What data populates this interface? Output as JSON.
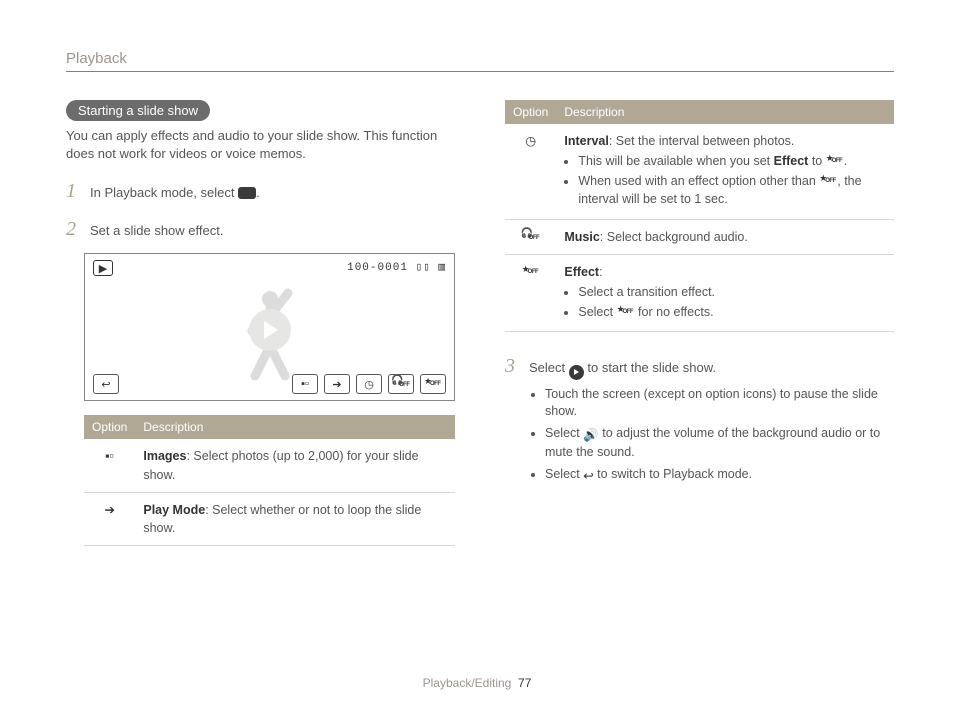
{
  "header": {
    "section": "Playback"
  },
  "pill": "Starting a slide show",
  "intro": "You can apply effects and audio to your slide show. This function does not work for videos or voice memos.",
  "steps": {
    "1": {
      "prefix": "In Playback mode, select ",
      "suffix": "."
    },
    "2": "Set a slide show effect.",
    "3": {
      "prefix": "Select ",
      "suffix": " to start the slide show."
    }
  },
  "screen": {
    "counter": "100-0001"
  },
  "table_headers": {
    "option": "Option",
    "description": "Description"
  },
  "left_options": [
    {
      "title": "Images",
      "body": ": Select photos (up to 2,000) for your slide show."
    },
    {
      "title": "Play Mode",
      "body": ": Select whether or not to loop the slide show."
    }
  ],
  "right_options": {
    "interval": {
      "title": "Interval",
      "lead": ": Set the interval between photos.",
      "b1a": "This will be available when you set ",
      "b1b": "Effect",
      "b1c": " to ",
      "b2a": "When used with an effect option other than ",
      "b2b": ", the interval will be set to 1 sec."
    },
    "music": {
      "title": "Music",
      "body": ": Select background audio."
    },
    "effect": {
      "title": "Effect",
      "colon": ":",
      "b1": "Select a transition effect.",
      "b2a": "Select ",
      "b2b": " for no effects."
    }
  },
  "post_steps": {
    "a": "Touch the screen (except on option icons) to pause the slide show.",
    "b1": "Select ",
    "b2": " to adjust the volume of the background audio or to mute the sound.",
    "c1": "Select ",
    "c2": " to switch to Playback mode."
  },
  "footer": {
    "path": "Playback/Editing",
    "page": "77"
  }
}
